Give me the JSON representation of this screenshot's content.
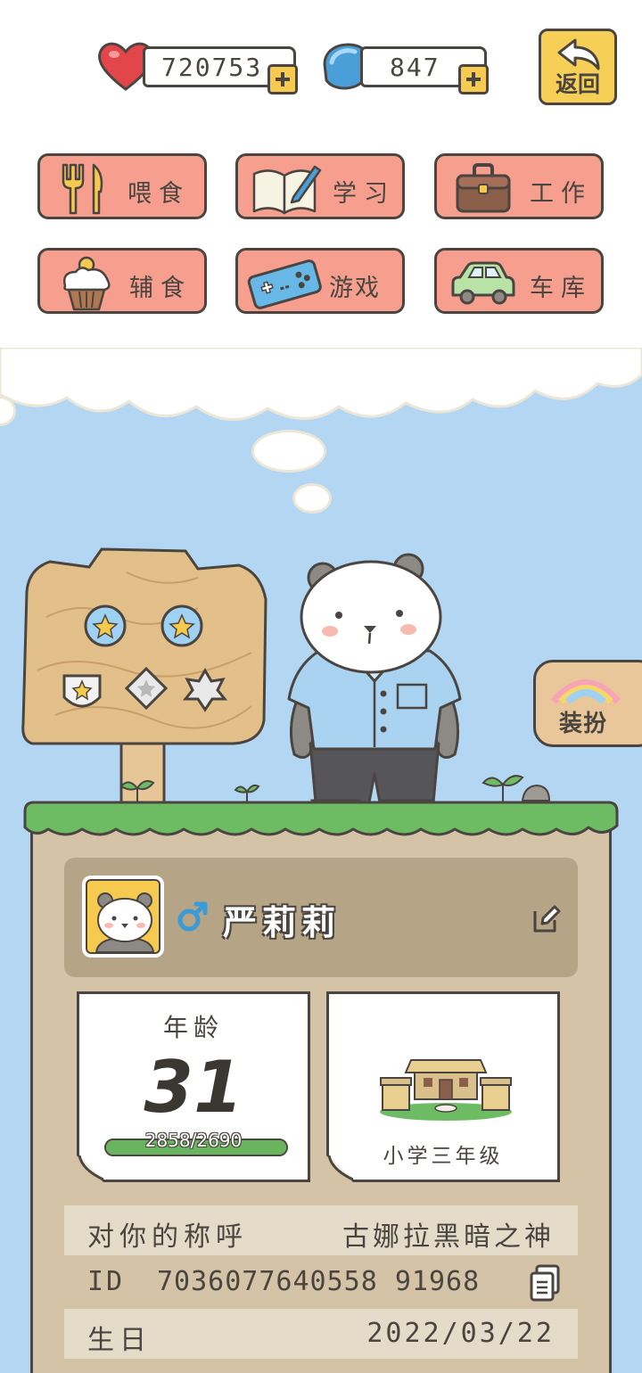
{
  "currency": {
    "hearts": "720753",
    "gems": "847"
  },
  "header": {
    "back_label": "返回"
  },
  "actions": [
    {
      "label": "喂食",
      "icon": "fork-knife-icon"
    },
    {
      "label": "学习",
      "icon": "book-pen-icon"
    },
    {
      "label": "工作",
      "icon": "briefcase-icon"
    },
    {
      "label": "辅食",
      "icon": "cupcake-icon"
    },
    {
      "label": "游戏",
      "icon": "gamepad-icon"
    },
    {
      "label": "车库",
      "icon": "car-icon"
    }
  ],
  "dress_up": {
    "label": "装扮"
  },
  "profile": {
    "name": "严莉莉",
    "gender": "male",
    "age_label": "年龄",
    "age": "31",
    "xp_text": "2858/2690",
    "xp_fraction": 1.0,
    "school": "小学三年级"
  },
  "info": {
    "title_key": "对你的称呼",
    "title_value": "古娜拉黑暗之神",
    "id_key": "ID",
    "id_value": "7036077640558 91968",
    "birthday_key": "生日",
    "birthday_value": "2022/03/22"
  },
  "colors": {
    "sky": "#b3d6f3",
    "button": "#f69f8e",
    "gold": "#f6c94f",
    "grass": "#6dbb62",
    "dirt": "#d4c3a6"
  }
}
